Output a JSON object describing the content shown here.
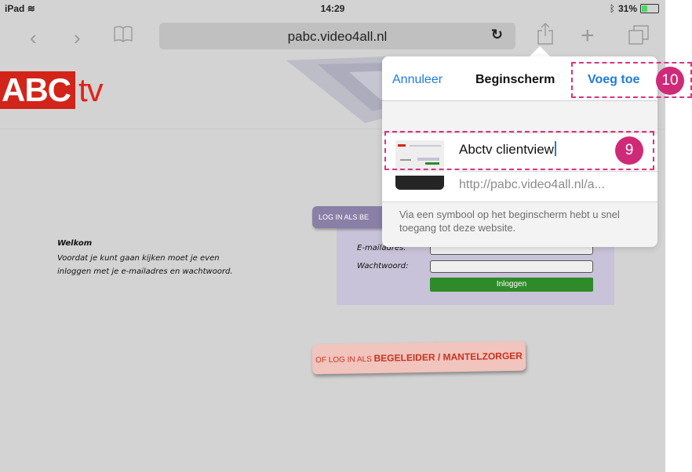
{
  "status_bar": {
    "device": "iPad",
    "time": "14:29",
    "battery": "31%"
  },
  "browser": {
    "url": "pabc.video4all.nl",
    "icons": [
      "back-icon",
      "forward-icon",
      "bookmarks-icon",
      "reload-icon",
      "share-icon",
      "new-tab-icon",
      "tabs-icon"
    ]
  },
  "site": {
    "welcome_title": "Welkom",
    "welcome_line1": "Voordat je kunt gaan kijken moet je even",
    "welcome_line2": "inloggen met je e-mailadres en wachtwoord.",
    "log_in_tab": "LOG IN ALS BE",
    "email_label": "E-mailadres:",
    "password_label": "Wachtwoord:",
    "login_button": "Inloggen",
    "alt_login_prefix": "OF LOG IN ALS ",
    "alt_login_main": "BEGELEIDER / MANTELZORGER"
  },
  "popover": {
    "cancel": "Annuleer",
    "title": "Beginscherm",
    "add": "Voeg toe",
    "name_value": "Abctv clientview",
    "url_value": "http://pabc.video4all.nl/a...",
    "hint": "Via een symbool op het beginscherm hebt u snel toegang tot deze website."
  },
  "annotations": {
    "step_add": "10",
    "step_name": "9",
    "highlight_color": "#d9337f"
  }
}
